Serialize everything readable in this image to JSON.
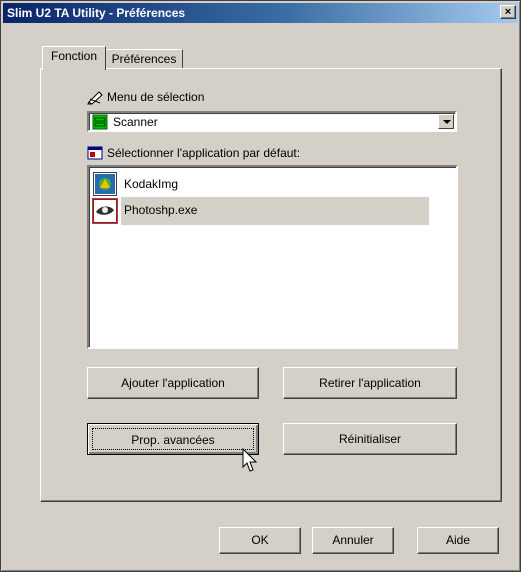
{
  "window": {
    "title": "Slim U2 TA Utility - Préférences",
    "close_glyph": "×"
  },
  "tabs": [
    {
      "label": "Fonction",
      "active": true
    },
    {
      "label": "Préférences",
      "active": false
    }
  ],
  "selection_menu": {
    "label": "Menu de sélection",
    "icon": "pen-icon",
    "selected_value": "Scanner",
    "value_icon": "scanner-icon"
  },
  "default_app": {
    "label": "Sélectionner l'application par défaut:",
    "icon": "window-app-icon",
    "items": [
      {
        "label": "KodakImg",
        "icon": "kodak-imaging-icon",
        "selected": false
      },
      {
        "label": "Photoshp.exe",
        "icon": "photoshop-eye-icon",
        "selected": true
      }
    ]
  },
  "buttons": {
    "add_app": "Ajouter l'application",
    "remove_app": "Retirer l'application",
    "advanced": "Prop. avancées",
    "reset": "Réinitialiser",
    "ok": "OK",
    "cancel": "Annuler",
    "help": "Aide"
  },
  "colors": {
    "title_gradient_start": "#0a246a",
    "title_gradient_end": "#a6caf0",
    "face": "#d4d0c8"
  }
}
